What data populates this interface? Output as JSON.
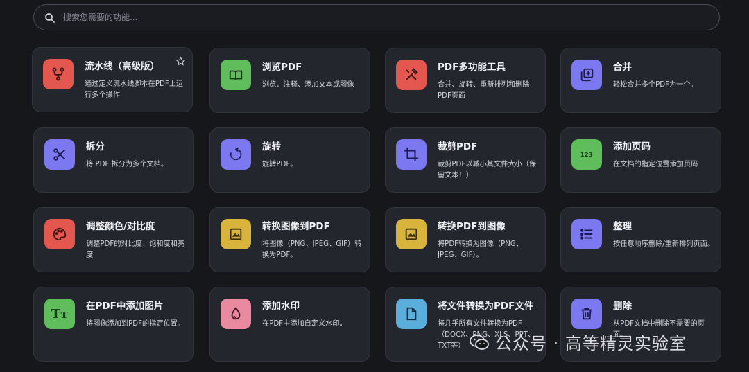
{
  "search": {
    "placeholder": "搜索您需要的功能..."
  },
  "cards": [
    {
      "title": "流水线（高级版）",
      "desc": "通过定义流水线脚本在PDF上运行多个操作",
      "icon": "pipeline-icon",
      "color": "#e4574f"
    },
    {
      "title": "浏览PDF",
      "desc": "浏览、注释、添加文本或图像",
      "icon": "book-icon",
      "color": "#5fbe5b"
    },
    {
      "title": "PDF多功能工具",
      "desc": "合并、旋转、重新排列和删除PDF页面",
      "icon": "tools-icon",
      "color": "#e4574f"
    },
    {
      "title": "合并",
      "desc": "轻松合并多个PDF为一个。",
      "icon": "merge-icon",
      "color": "#7b78f0"
    },
    {
      "title": "拆分",
      "desc": "将 PDF 拆分为多个文档。",
      "icon": "scissors-icon",
      "color": "#7b78f0"
    },
    {
      "title": "旋转",
      "desc": "旋转PDF。",
      "icon": "rotate-icon",
      "color": "#7b78f0"
    },
    {
      "title": "裁剪PDF",
      "desc": "裁剪PDF以减小其文件大小（保留文本！）",
      "icon": "crop-icon",
      "color": "#7b78f0"
    },
    {
      "title": "添加页码",
      "desc": "在文档的指定位置添加页码",
      "icon": "page-number-icon",
      "icon_text": "123",
      "color": "#5fbe5b"
    },
    {
      "title": "调整颜色/对比度",
      "desc": "调整PDF的对比度、饱和度和亮度",
      "icon": "palette-icon",
      "color": "#e4574f"
    },
    {
      "title": "转换图像到PDF",
      "desc": "将图像（PNG、JPEG、GIF）转换为PDF。",
      "icon": "image-icon",
      "color": "#d9b43c"
    },
    {
      "title": "转换PDF到图像",
      "desc": "将PDF转换为图像（PNG、JPEG、GIF）。",
      "icon": "image-icon",
      "color": "#d9b43c"
    },
    {
      "title": "整理",
      "desc": "按任意顺序删除/重新排列页面。",
      "icon": "list-icon",
      "color": "#7b78f0"
    },
    {
      "title": "在PDF中添加图片",
      "desc": "将图像添加到PDF的指定位置。",
      "icon": "text-icon",
      "icon_text": "Tт",
      "color": "#5fbe5b"
    },
    {
      "title": "添加水印",
      "desc": "在PDF中添加自定义水印。",
      "icon": "droplet-icon",
      "color": "#ea8aa0"
    },
    {
      "title": "将文件转换为PDF文件",
      "desc": "将几乎所有文件转换为PDF（DOCX、PNG、XLS、PPT、TXT等）",
      "icon": "file-icon",
      "color": "#5aaedc"
    },
    {
      "title": "删除",
      "desc": "从PDF文档中删除不需要的页面。",
      "icon": "trash-icon",
      "color": "#7b78f0"
    }
  ],
  "watermark": {
    "text": "公众号 · 高等精灵实验室"
  }
}
